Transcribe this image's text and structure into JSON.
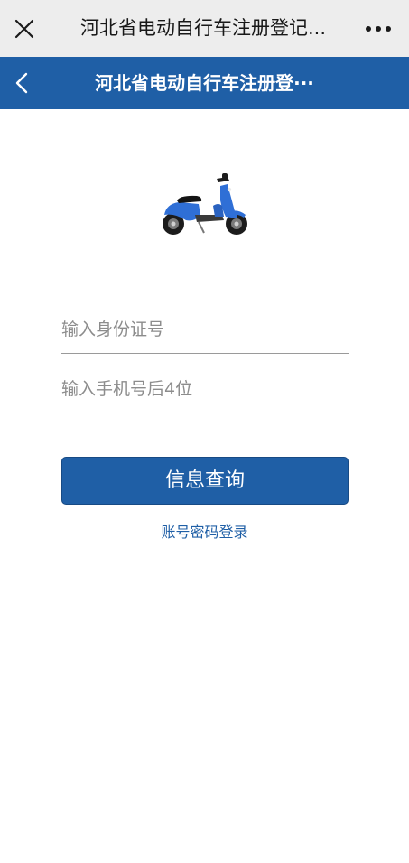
{
  "wechat_bar": {
    "title": "河北省电动自行车注册登记...",
    "close_icon": "close-icon",
    "more_icon": "more-dots-icon"
  },
  "header": {
    "title": "河北省电动自行车注册登···",
    "back_icon": "chevron-left-icon",
    "background": "#1f5fa6"
  },
  "hero": {
    "image": "scooter-icon",
    "body_color": "#2f6fd6"
  },
  "form": {
    "id_placeholder": "输入身份证号",
    "phone_placeholder": "输入手机号后4位",
    "submit_label": "信息查询",
    "alt_login_label": "账号密码登录"
  },
  "colors": {
    "accent": "#1f5fa6",
    "topbar": "#ededed"
  }
}
